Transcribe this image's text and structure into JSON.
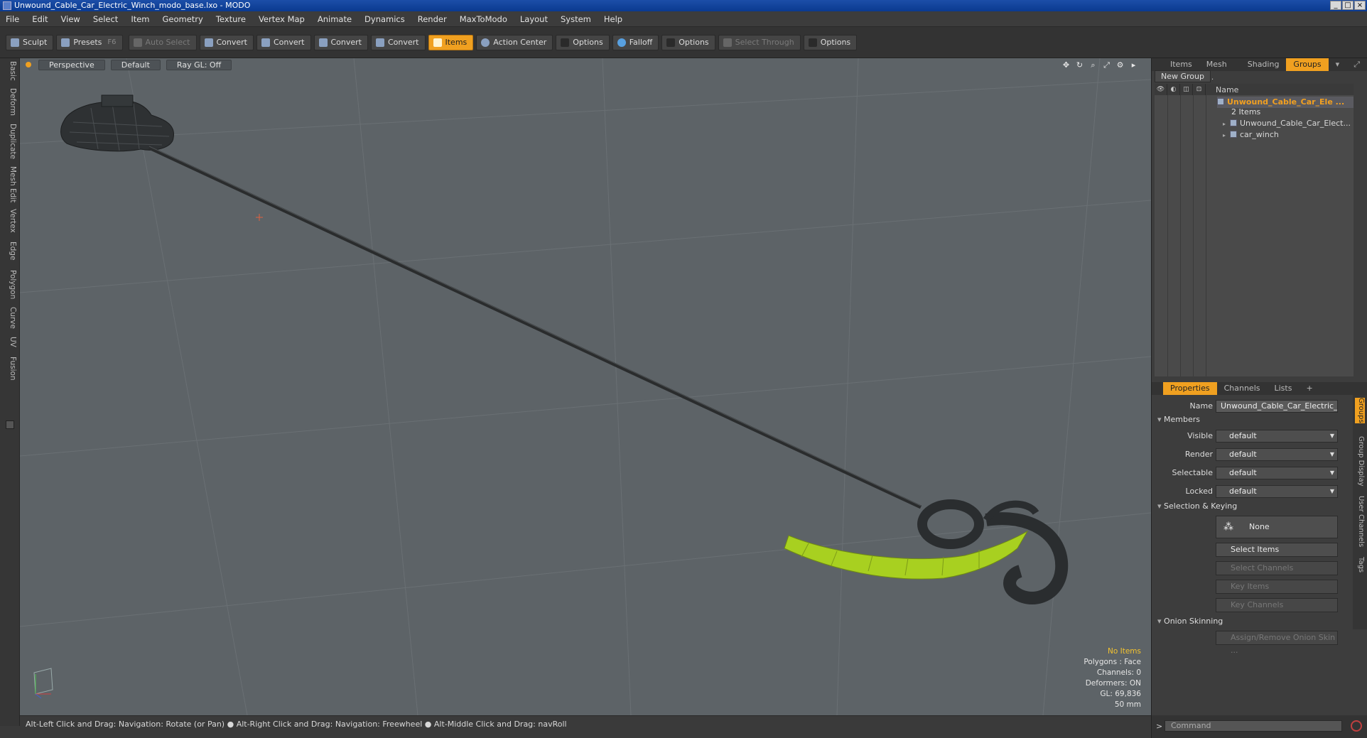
{
  "window": {
    "title": "Unwound_Cable_Car_Electric_Winch_modo_base.lxo - MODO"
  },
  "menu": [
    "File",
    "Edit",
    "View",
    "Select",
    "Item",
    "Geometry",
    "Texture",
    "Vertex Map",
    "Animate",
    "Dynamics",
    "Render",
    "MaxToModo",
    "Layout",
    "System",
    "Help"
  ],
  "toolbar": {
    "sculpt": "Sculpt",
    "presets": "Presets",
    "presets_key": "F6",
    "auto_select": "Auto Select",
    "convert_1": "Convert",
    "convert_2": "Convert",
    "convert_3": "Convert",
    "convert_4": "Convert",
    "items": "Items",
    "action_center": "Action Center",
    "options_1": "Options",
    "falloff": "Falloff",
    "options_2": "Options",
    "select_through": "Select Through",
    "options_3": "Options"
  },
  "left_tabs": [
    "Basic",
    "Deform",
    "Duplicate",
    "Mesh Edit",
    "Vertex",
    "Edge",
    "Polygon",
    "Curve",
    "UV",
    "Fusion"
  ],
  "viewport": {
    "view": "Perspective",
    "shading": "Default",
    "raygl": "Ray GL: Off",
    "info": {
      "no_items": "No Items",
      "polygons": "Polygons : Face",
      "channels": "Channels: 0",
      "deformers": "Deformers: ON",
      "gl": "GL: 69,836",
      "units": "50 mm"
    }
  },
  "status": "Alt-Left Click and Drag: Navigation: Rotate (or Pan) ● Alt-Right Click and Drag: Navigation: Freewheel ● Alt-Middle Click and Drag: navRoll",
  "right_panel": {
    "tabs": [
      "Items",
      "Mesh ...",
      "Shading",
      "Groups"
    ],
    "active_tab": "Groups",
    "new_group": "New Group",
    "tree_header_name": "Name",
    "group_name": "Unwound_Cable_Car_Ele ...",
    "group_count": "2 Items",
    "child_1": "Unwound_Cable_Car_Elect...",
    "child_2": "car_winch",
    "prop_tabs": [
      "Properties",
      "Channels",
      "Lists",
      "+"
    ],
    "props": {
      "name_label": "Name",
      "name_value": "Unwound_Cable_Car_Electric_W",
      "members": "Members",
      "visible_label": "Visible",
      "visible_value": "default",
      "render_label": "Render",
      "render_value": "default",
      "selectable_label": "Selectable",
      "selectable_value": "default",
      "locked_label": "Locked",
      "locked_value": "default",
      "selection_keying": "Selection & Keying",
      "none": "None",
      "select_items": "Select Items",
      "select_channels": "Select Channels",
      "key_items": "Key Items",
      "key_channels": "Key Channels",
      "onion": "Onion Skinning",
      "assign_onion": "Assign/Remove Onion Skin ..."
    },
    "side_tabs": [
      "Groups",
      "Group Display",
      "User Channels",
      "Tags"
    ],
    "command_placeholder": "Command"
  },
  "colors": {
    "accent": "#f0a020",
    "viewport_bg": "#5d6367",
    "highlight_mesh": "#a8d020"
  }
}
